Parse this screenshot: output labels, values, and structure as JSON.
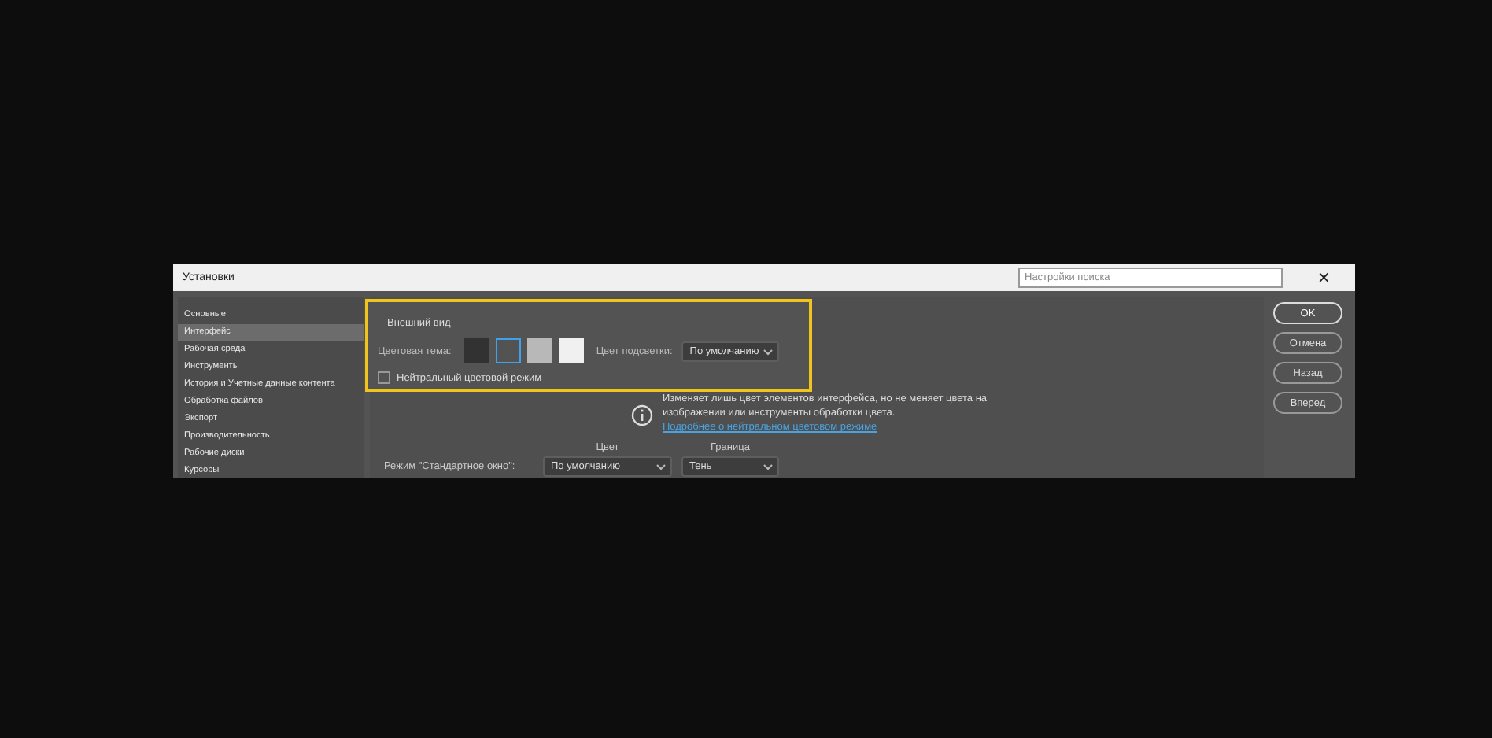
{
  "window": {
    "title": "Установки",
    "search": {
      "placeholder": "Настройки поиска"
    },
    "close": "✕"
  },
  "sidebar": {
    "items": [
      {
        "label": "Основные",
        "selected": false
      },
      {
        "label": "Интерфейс",
        "selected": true
      },
      {
        "label": "Рабочая среда",
        "selected": false
      },
      {
        "label": "Инструменты",
        "selected": false
      },
      {
        "label": "История и Учетные данные контента",
        "selected": false
      },
      {
        "label": "Обработка файлов",
        "selected": false
      },
      {
        "label": "Экспорт",
        "selected": false
      },
      {
        "label": "Производительность",
        "selected": false
      },
      {
        "label": "Рабочие диски",
        "selected": false
      },
      {
        "label": "Курсоры",
        "selected": false
      }
    ]
  },
  "appearance": {
    "title": "Внешний вид",
    "theme_label": "Цветовая тема:",
    "themes": [
      {
        "color": "#323232",
        "selected": false
      },
      {
        "color": "#535353",
        "selected": true
      },
      {
        "color": "#b8b8b8",
        "selected": false
      },
      {
        "color": "#f0f0f0",
        "selected": false
      }
    ],
    "highlight_label": "Цвет подсветки:",
    "highlight_value": "По умолчанию",
    "neutral_mode": {
      "label": "Нейтральный цветовой режим",
      "checked": false
    }
  },
  "info": {
    "text": "Изменяет лишь цвет элементов интерфейса, но не меняет цвета на изображении или инструменты обработки цвета.",
    "link": "Подробнее о нейтральном цветовом режиме"
  },
  "modes": {
    "columns": [
      "Цвет",
      "Граница"
    ],
    "rows": [
      {
        "label": "Режим \"Стандартное окно\":",
        "color_mode": "По умолчанию",
        "border": "Тень"
      }
    ]
  },
  "buttons": [
    {
      "label": "OK",
      "primary": true
    },
    {
      "label": "Отмена",
      "primary": false
    },
    {
      "label": "Назад",
      "primary": false
    },
    {
      "label": "Вперед",
      "primary": false
    }
  ]
}
